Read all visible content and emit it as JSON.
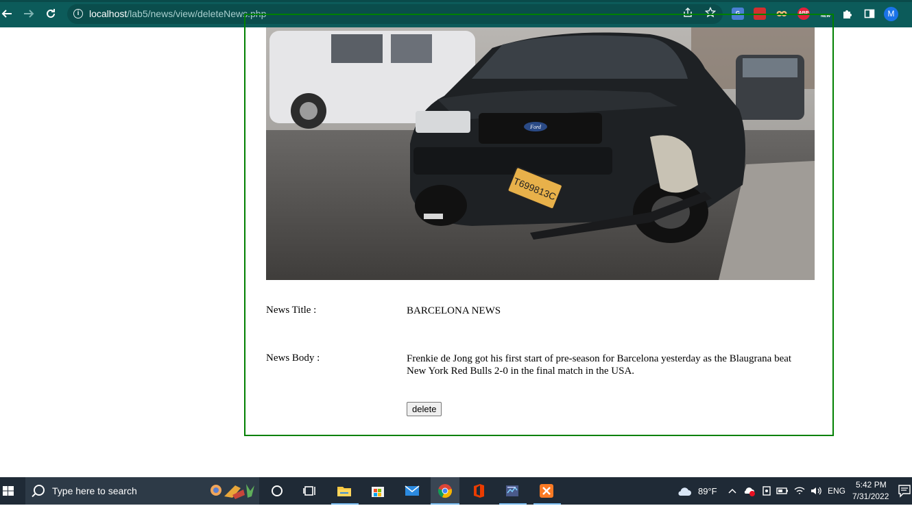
{
  "browser": {
    "url_host": "localhost",
    "url_path": "/lab5/news/view/deleteNews.php",
    "profile_initial": "M",
    "extensions": [
      "google-translate-icon",
      "bookmark-extension-icon",
      "eyes-extension-icon",
      "adblock-plus-icon",
      "new-extension-icon",
      "puzzle-extensions-icon",
      "side-panel-icon"
    ],
    "adblock_label": "ABP",
    "new_label": "NEW"
  },
  "news": {
    "title_label": "News Title :",
    "title_value": "BARCELONA NEWS",
    "body_label": "News Body :",
    "body_value": "Frenkie de Jong got his first start of pre-season for Barcelona yesterday as the Blaugrana beat New York Red Bulls 2-0 in the final match in the USA.",
    "delete_label": "delete",
    "image_plate_text": "T699813C",
    "image_brand_text": "Ford"
  },
  "taskbar": {
    "search_placeholder": "Type here to search",
    "weather_temp": "89°F",
    "language": "ENG",
    "time": "5:42 PM",
    "date": "7/31/2022"
  },
  "colors": {
    "browser_bar": "#0c5b5a",
    "card_border": "#008000",
    "taskbar": "#1f2a36"
  }
}
